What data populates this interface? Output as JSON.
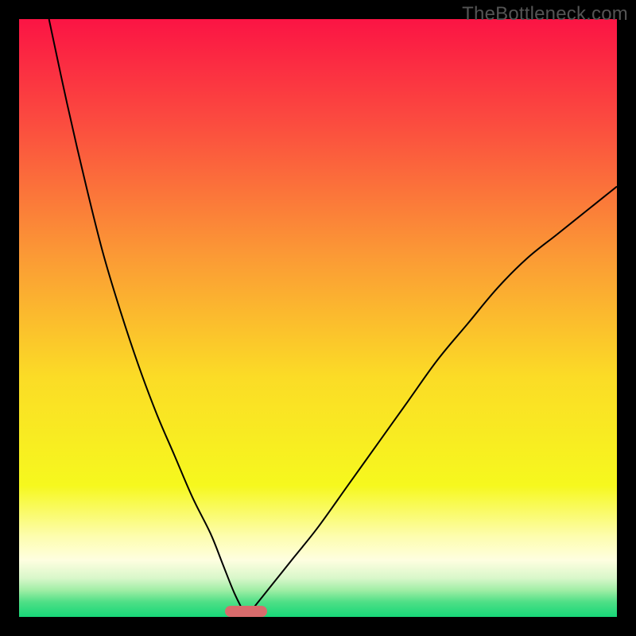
{
  "watermark": "TheBottleneck.com",
  "colors": {
    "frame": "#000000",
    "curve": "#000000",
    "marker": "#d86b6c",
    "gradient_stops": [
      {
        "offset": 0.0,
        "color": "#fb1444"
      },
      {
        "offset": 0.18,
        "color": "#fb4e3f"
      },
      {
        "offset": 0.4,
        "color": "#fb9b35"
      },
      {
        "offset": 0.6,
        "color": "#fbdc26"
      },
      {
        "offset": 0.78,
        "color": "#f6f81e"
      },
      {
        "offset": 0.865,
        "color": "#fdfdae"
      },
      {
        "offset": 0.905,
        "color": "#fefee0"
      },
      {
        "offset": 0.935,
        "color": "#d9f7ca"
      },
      {
        "offset": 0.955,
        "color": "#a1eea6"
      },
      {
        "offset": 0.975,
        "color": "#4fdf86"
      },
      {
        "offset": 1.0,
        "color": "#17d778"
      }
    ]
  },
  "chart_data": {
    "type": "line",
    "title": "",
    "xlabel": "",
    "ylabel": "",
    "xlim": [
      0,
      100
    ],
    "ylim": [
      0,
      100
    ],
    "x_optimal": 38,
    "curve_left": {
      "name": "left-branch",
      "x": [
        5,
        8,
        11,
        14,
        17,
        20,
        23,
        26,
        29,
        32,
        34,
        36,
        38
      ],
      "y": [
        100,
        86,
        73,
        61,
        51,
        42,
        34,
        27,
        20,
        14,
        9,
        4,
        0
      ]
    },
    "curve_right": {
      "name": "right-branch",
      "x": [
        38,
        42,
        46,
        50,
        55,
        60,
        65,
        70,
        75,
        80,
        85,
        90,
        95,
        100
      ],
      "y": [
        0,
        5,
        10,
        15,
        22,
        29,
        36,
        43,
        49,
        55,
        60,
        64,
        68,
        72
      ]
    },
    "marker": {
      "x_center": 38,
      "width": 7,
      "y": 0
    }
  }
}
